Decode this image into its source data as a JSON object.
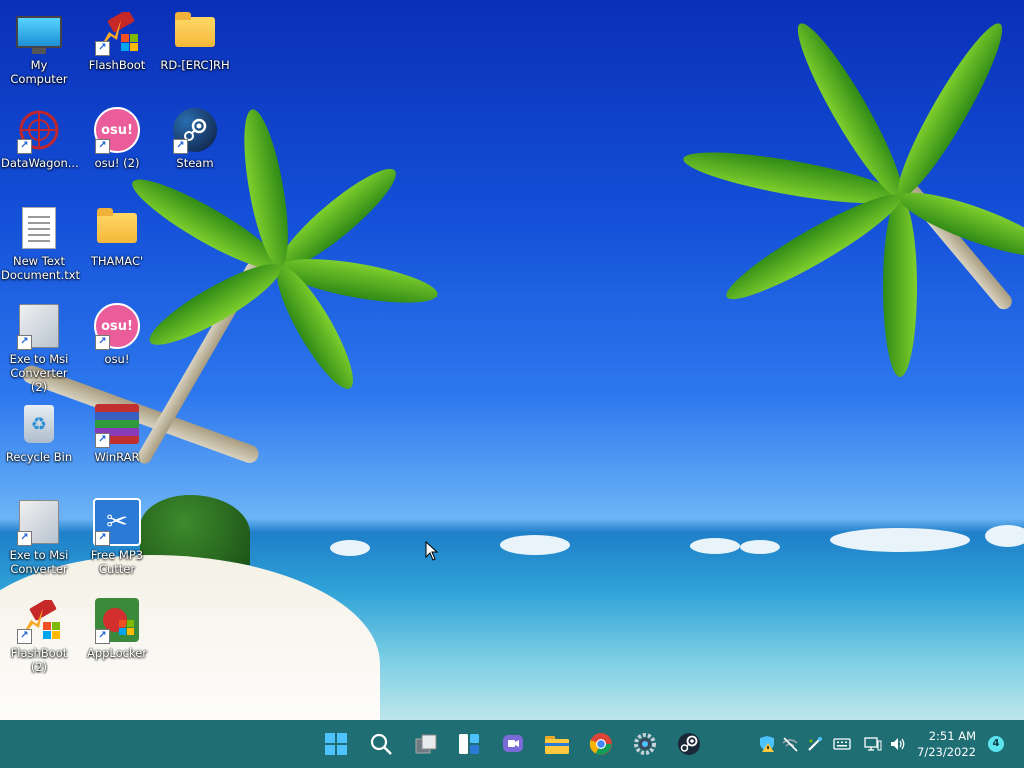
{
  "desktop_icons": [
    {
      "name": "mycomputer",
      "label": "My Computer",
      "icon": "monitor-icon",
      "shortcut": false
    },
    {
      "name": "flashboot",
      "label": "FlashBoot",
      "icon": "flashboot-icon",
      "shortcut": true
    },
    {
      "name": "rd-folder",
      "label": "RD-[ERC]RH",
      "icon": "folder-icon",
      "shortcut": false
    },
    {
      "name": "datawagon",
      "label": "DataWagon...",
      "icon": "datawagon-icon",
      "shortcut": true
    },
    {
      "name": "osu2",
      "label": "osu! (2)",
      "icon": "osu-icon",
      "shortcut": true
    },
    {
      "name": "steam",
      "label": "Steam",
      "icon": "steam-icon",
      "shortcut": true
    },
    {
      "name": "newtext",
      "label": "New Text Document.txt",
      "icon": "text-document-icon",
      "shortcut": false
    },
    {
      "name": "thamac",
      "label": "THAMAC'",
      "icon": "folder-icon",
      "shortcut": false
    },
    {
      "name": "exetomsi2",
      "label": "Exe to Msi Converter (2)",
      "icon": "installer-icon",
      "shortcut": true
    },
    {
      "name": "osu",
      "label": "osu!",
      "icon": "osu-icon",
      "shortcut": true
    },
    {
      "name": "recyclebin",
      "label": "Recycle Bin",
      "icon": "recycle-bin-icon",
      "shortcut": false
    },
    {
      "name": "winrar",
      "label": "WinRAR",
      "icon": "winrar-icon",
      "shortcut": true
    },
    {
      "name": "exetomsi",
      "label": "Exe to Msi Converter",
      "icon": "installer-icon",
      "shortcut": true
    },
    {
      "name": "freemp3cutter",
      "label": "Free MP3 Cutter",
      "icon": "scissors-icon",
      "shortcut": true
    },
    {
      "name": "flashboot2",
      "label": "FlashBoot (2)",
      "icon": "flashboot-icon",
      "shortcut": true
    },
    {
      "name": "applocker",
      "label": "AppLocker",
      "icon": "applocker-icon",
      "shortcut": true
    }
  ],
  "osu_text": "osu!",
  "taskbar": {
    "apps": [
      "start-icon",
      "search-icon",
      "task-view-icon",
      "widgets-icon",
      "chat-icon",
      "file-explorer-icon",
      "chrome-icon",
      "settings-icon",
      "steam-icon"
    ],
    "tray": [
      "defender-warning-icon",
      "network-off-icon",
      "pen-icon",
      "keyboard-icon",
      "display-icon",
      "volume-icon"
    ],
    "time": "2:51 AM",
    "date": "7/23/2022",
    "notifications": "4"
  }
}
